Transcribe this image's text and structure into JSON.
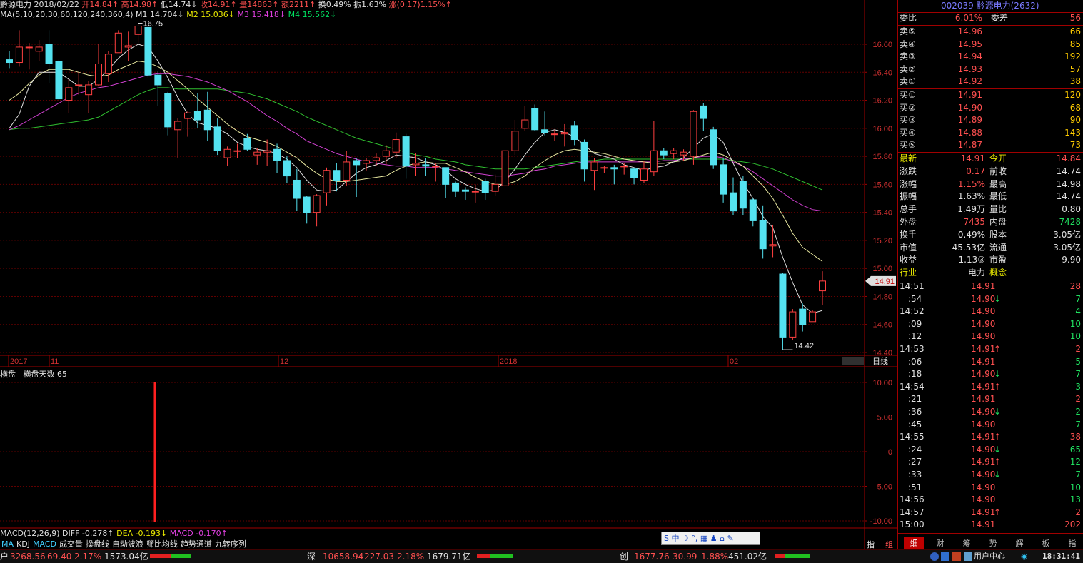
{
  "header": {
    "name": "黔源电力",
    "date": "2018/02/22",
    "open": "开14.84↑",
    "high": "高14.98↑",
    "low": "低14.74↓",
    "close": "收14.91↑",
    "volume": "量14863↑",
    "amount": "额2211↑",
    "turnover": "换0.49%",
    "amplitude": "振1.63%",
    "change": "涨(0.17)1.15%↑"
  },
  "ma_line": {
    "label": "MA(5,10,20,30,60,120,240,360,4)",
    "m1": "M1 14.704↓",
    "m2": "M2 15.036↓",
    "m3": "M3 15.418↓",
    "m4": "M4 15.562↓"
  },
  "chart_data": {
    "type": "candlestick",
    "y_ticks": [
      "16.60",
      "16.40",
      "16.20",
      "16.00",
      "15.80",
      "15.60",
      "15.40",
      "15.20",
      "15.00",
      "14.80",
      "14.60",
      "14.40"
    ],
    "ylim": [
      14.4,
      16.9
    ],
    "x_labels": [
      "2017",
      "11",
      "12",
      "2018",
      "02"
    ],
    "high_marker": "16.75",
    "low_marker": "14.42",
    "last_price_tag": "14.91",
    "period_label": "日线",
    "candles": [
      [
        16.49,
        16.47,
        16.55,
        16.43
      ],
      [
        16.47,
        16.58,
        16.7,
        16.44
      ],
      [
        16.58,
        16.58,
        16.61,
        16.42
      ],
      [
        16.55,
        16.58,
        16.63,
        16.48
      ],
      [
        16.6,
        16.46,
        16.7,
        16.32
      ],
      [
        16.48,
        16.21,
        16.49,
        16.2
      ],
      [
        16.2,
        16.29,
        16.35,
        16.11
      ],
      [
        16.31,
        16.31,
        16.4,
        16.24
      ],
      [
        16.24,
        16.31,
        16.34,
        16.11
      ],
      [
        16.31,
        16.46,
        16.6,
        16.3
      ],
      [
        16.39,
        16.53,
        16.55,
        16.33
      ],
      [
        16.54,
        16.68,
        16.7,
        16.54
      ],
      [
        16.58,
        16.59,
        16.69,
        16.48
      ],
      [
        16.67,
        16.73,
        16.75,
        16.61
      ],
      [
        16.72,
        16.38,
        16.73,
        16.36
      ],
      [
        16.38,
        16.31,
        16.41,
        16.16
      ],
      [
        16.25,
        16.01,
        16.26,
        15.95
      ],
      [
        15.99,
        16.05,
        16.07,
        15.79
      ],
      [
        16.07,
        16.11,
        16.12,
        15.94
      ],
      [
        16.12,
        16.06,
        16.25,
        16.0
      ],
      [
        16.13,
        15.99,
        16.26,
        15.91
      ],
      [
        16.01,
        15.84,
        16.07,
        15.81
      ],
      [
        15.79,
        15.85,
        15.87,
        15.73
      ],
      [
        15.84,
        15.84,
        15.89,
        15.79
      ],
      [
        15.93,
        15.85,
        15.96,
        15.84
      ],
      [
        15.81,
        15.83,
        15.86,
        15.74
      ],
      [
        15.83,
        15.84,
        15.92,
        15.73
      ],
      [
        15.85,
        15.77,
        15.89,
        15.68
      ],
      [
        15.77,
        15.66,
        15.8,
        15.61
      ],
      [
        15.63,
        15.5,
        15.71,
        15.41
      ],
      [
        15.51,
        15.4,
        15.52,
        15.32
      ],
      [
        15.4,
        15.52,
        15.53,
        15.3
      ],
      [
        15.54,
        15.7,
        15.72,
        15.45
      ],
      [
        15.7,
        15.63,
        15.75,
        15.55
      ],
      [
        15.63,
        15.76,
        15.84,
        15.59
      ],
      [
        15.77,
        15.74,
        15.79,
        15.51
      ],
      [
        15.75,
        15.77,
        15.79,
        15.7
      ],
      [
        15.77,
        15.79,
        15.82,
        15.73
      ],
      [
        15.8,
        15.84,
        15.88,
        15.74
      ],
      [
        15.83,
        15.92,
        15.97,
        15.79
      ],
      [
        15.94,
        15.73,
        15.96,
        15.64
      ],
      [
        15.74,
        15.75,
        15.82,
        15.66
      ],
      [
        15.74,
        15.73,
        15.79,
        15.66
      ],
      [
        15.73,
        15.73,
        15.75,
        15.62
      ],
      [
        15.72,
        15.6,
        15.72,
        15.5
      ],
      [
        15.61,
        15.55,
        15.62,
        15.51
      ],
      [
        15.56,
        15.55,
        15.58,
        15.49
      ],
      [
        15.55,
        15.55,
        15.6,
        15.47
      ],
      [
        15.62,
        15.54,
        15.64,
        15.49
      ],
      [
        15.55,
        15.6,
        15.67,
        15.52
      ],
      [
        15.59,
        15.84,
        15.94,
        15.57
      ],
      [
        15.84,
        15.98,
        16.06,
        15.81
      ],
      [
        16.0,
        16.06,
        16.16,
        15.98
      ],
      [
        16.14,
        15.99,
        16.17,
        15.98
      ],
      [
        15.99,
        15.97,
        16.12,
        15.95
      ],
      [
        15.96,
        15.96,
        15.99,
        15.91
      ],
      [
        15.96,
        15.97,
        16.03,
        15.87
      ],
      [
        16.02,
        15.92,
        16.05,
        15.88
      ],
      [
        15.9,
        15.71,
        15.92,
        15.62
      ],
      [
        15.7,
        15.76,
        15.79,
        15.56
      ],
      [
        15.72,
        15.72,
        15.73,
        15.68
      ],
      [
        15.72,
        15.71,
        15.74,
        15.6
      ],
      [
        15.73,
        15.73,
        15.75,
        15.67
      ],
      [
        15.71,
        15.65,
        15.72,
        15.6
      ],
      [
        15.63,
        15.71,
        15.77,
        15.61
      ],
      [
        15.69,
        15.84,
        16.05,
        15.66
      ],
      [
        15.84,
        15.81,
        15.86,
        15.78
      ],
      [
        15.82,
        15.84,
        15.86,
        15.78
      ],
      [
        15.81,
        15.83,
        15.85,
        15.77
      ],
      [
        15.8,
        16.12,
        16.13,
        15.74
      ],
      [
        16.16,
        16.07,
        16.18,
        15.98
      ],
      [
        15.99,
        15.74,
        16.01,
        15.71
      ],
      [
        15.74,
        15.53,
        15.79,
        15.47
      ],
      [
        15.54,
        15.41,
        15.65,
        15.38
      ],
      [
        15.62,
        15.43,
        15.66,
        15.38
      ],
      [
        15.49,
        15.34,
        15.5,
        15.3
      ],
      [
        15.34,
        15.14,
        15.45,
        15.07
      ],
      [
        15.16,
        15.17,
        15.31,
        15.08
      ],
      [
        14.96,
        14.51,
        14.97,
        14.42
      ],
      [
        14.51,
        14.69,
        14.71,
        14.49
      ],
      [
        14.71,
        14.6,
        14.75,
        14.55
      ],
      [
        14.62,
        14.69,
        14.7,
        14.65
      ],
      [
        14.84,
        14.91,
        14.98,
        14.74
      ]
    ],
    "ma5_y": [
      16.0,
      16.1,
      16.3,
      16.4,
      16.4,
      16.4,
      16.35,
      16.3,
      16.3,
      16.35,
      16.42,
      16.5,
      16.56,
      16.6,
      16.58,
      16.48,
      16.36,
      16.22,
      16.1,
      16.04,
      16.02,
      16.0,
      15.96,
      15.9,
      15.87,
      15.85,
      15.84,
      15.82,
      15.78,
      15.72,
      15.63,
      15.56,
      15.55,
      15.56,
      15.62,
      15.68,
      15.72,
      15.74,
      15.77,
      15.81,
      15.8,
      15.79,
      15.76,
      15.74,
      15.7,
      15.64,
      15.6,
      15.57,
      15.55,
      15.56,
      15.62,
      15.71,
      15.81,
      15.9,
      15.97,
      15.99,
      15.97,
      15.94,
      15.88,
      15.82,
      15.8,
      15.78,
      15.74,
      15.72,
      15.7,
      15.72,
      15.73,
      15.76,
      15.79,
      15.86,
      15.93,
      15.96,
      15.9,
      15.75,
      15.61,
      15.5,
      15.37,
      15.29,
      15.08,
      14.9,
      14.74,
      14.68,
      14.7
    ],
    "ma10_y": [
      16.2,
      16.25,
      16.32,
      16.38,
      16.42,
      16.42,
      16.42,
      16.4,
      16.38,
      16.37,
      16.38,
      16.42,
      16.45,
      16.48,
      16.47,
      16.44,
      16.4,
      16.34,
      16.28,
      16.21,
      16.15,
      16.09,
      16.03,
      15.98,
      15.94,
      15.92,
      15.9,
      15.87,
      15.83,
      15.79,
      15.73,
      15.68,
      15.64,
      15.62,
      15.62,
      15.63,
      15.64,
      15.65,
      15.66,
      15.7,
      15.73,
      15.75,
      15.76,
      15.75,
      15.75,
      15.72,
      15.69,
      15.65,
      15.62,
      15.6,
      15.6,
      15.62,
      15.66,
      15.72,
      15.77,
      15.81,
      15.84,
      15.85,
      15.84,
      15.83,
      15.82,
      15.8,
      15.78,
      15.77,
      15.76,
      15.75,
      15.75,
      15.76,
      15.77,
      15.79,
      15.81,
      15.83,
      15.81,
      15.77,
      15.73,
      15.66,
      15.59,
      15.5,
      15.38,
      15.25,
      15.15,
      15.1,
      15.05
    ],
    "ma20_y": [
      15.99,
      16.02,
      16.06,
      16.1,
      16.14,
      16.18,
      16.22,
      16.25,
      16.27,
      16.29,
      16.3,
      16.32,
      16.34,
      16.36,
      16.38,
      16.39,
      16.39,
      16.38,
      16.37,
      16.35,
      16.33,
      16.3,
      16.27,
      16.23,
      16.19,
      16.14,
      16.09,
      16.05,
      16.0,
      15.96,
      15.91,
      15.88,
      15.85,
      15.82,
      15.8,
      15.78,
      15.76,
      15.75,
      15.74,
      15.73,
      15.73,
      15.72,
      15.72,
      15.72,
      15.71,
      15.7,
      15.69,
      15.68,
      15.67,
      15.66,
      15.66,
      15.67,
      15.68,
      15.7,
      15.71,
      15.73,
      15.74,
      15.75,
      15.76,
      15.76,
      15.76,
      15.76,
      15.76,
      15.76,
      15.76,
      15.76,
      15.77,
      15.77,
      15.78,
      15.79,
      15.8,
      15.8,
      15.79,
      15.76,
      15.73,
      15.69,
      15.64,
      15.59,
      15.54,
      15.49,
      15.45,
      15.42,
      15.41
    ],
    "ma30_y": [
      15.99,
      16.0,
      16.0,
      16.01,
      16.02,
      16.03,
      16.04,
      16.05,
      16.06,
      16.08,
      16.12,
      16.16,
      16.2,
      16.24,
      16.27,
      16.29,
      16.29,
      16.28,
      16.28,
      16.28,
      16.28,
      16.28,
      16.27,
      16.26,
      16.25,
      16.23,
      16.21,
      16.18,
      16.15,
      16.12,
      16.08,
      16.05,
      16.02,
      15.99,
      15.96,
      15.93,
      15.91,
      15.89,
      15.87,
      15.85,
      15.83,
      15.81,
      15.8,
      15.78,
      15.77,
      15.76,
      15.74,
      15.73,
      15.72,
      15.71,
      15.71,
      15.71,
      15.71,
      15.72,
      15.73,
      15.74,
      15.75,
      15.76,
      15.77,
      15.77,
      15.78,
      15.78,
      15.78,
      15.78,
      15.78,
      15.78,
      15.78,
      15.78,
      15.78,
      15.78,
      15.78,
      15.78,
      15.78,
      15.77,
      15.76,
      15.75,
      15.73,
      15.71,
      15.68,
      15.65,
      15.62,
      15.59,
      15.56
    ]
  },
  "indicator": {
    "label": "横盘",
    "days_label": "横盘天数 65",
    "y_ticks": [
      "10.00",
      "5.00",
      "0",
      "-5.00",
      "-10.00"
    ]
  },
  "macd": {
    "label": "MACD(12,26,9)",
    "diff": "DIFF -0.278↑",
    "dea": "DEA -0.193↓",
    "macd": "MACD -0.170↑"
  },
  "tabs": [
    "MA",
    "KDJ",
    "MACD",
    "成交量",
    "操盘线",
    "自动波浪",
    "筛比均线",
    "趋势通道",
    "九转序列"
  ],
  "ime_bar": "S 中 ☽ °, ▦ ♟ ⌂ ✎",
  "side": {
    "title": "002039 黔源电力(2632)",
    "weibi_label": "委比",
    "weibi_value": "6.01%",
    "weicha_label": "委差",
    "weicha_value": "56",
    "asks": [
      {
        "label": "卖⑤",
        "price": "14.96",
        "vol": "66"
      },
      {
        "label": "卖④",
        "price": "14.95",
        "vol": "85"
      },
      {
        "label": "卖③",
        "price": "14.94",
        "vol": "192"
      },
      {
        "label": "卖②",
        "price": "14.93",
        "vol": "57"
      },
      {
        "label": "卖①",
        "price": "14.92",
        "vol": "38"
      }
    ],
    "bids": [
      {
        "label": "买①",
        "price": "14.91",
        "vol": "120"
      },
      {
        "label": "买②",
        "price": "14.90",
        "vol": "68"
      },
      {
        "label": "买③",
        "price": "14.89",
        "vol": "90"
      },
      {
        "label": "买④",
        "price": "14.88",
        "vol": "143"
      },
      {
        "label": "买⑤",
        "price": "14.87",
        "vol": "73"
      }
    ],
    "stats": [
      {
        "k1": "最新",
        "v1": "14.91",
        "k2": "今开",
        "v2": "14.84"
      },
      {
        "k1": "涨跌",
        "v1": "0.17",
        "k2": "前收",
        "v2": "14.74"
      },
      {
        "k1": "涨幅",
        "v1": "1.15%",
        "k2": "最高",
        "v2": "14.98"
      },
      {
        "k1": "振幅",
        "v1": "1.63%",
        "k2": "最低",
        "v2": "14.74"
      },
      {
        "k1": "总手",
        "v1": "1.49万",
        "k2": "量比",
        "v2": "0.80"
      },
      {
        "k1": "外盘",
        "v1": "7435",
        "k2": "内盘",
        "v2": "7428"
      },
      {
        "k1": "换手",
        "v1": "0.49%",
        "k2": "股本",
        "v2": "3.05亿"
      },
      {
        "k1": "市值",
        "v1": "45.53亿",
        "k2": "流通",
        "v2": "3.05亿"
      },
      {
        "k1": "收益",
        "v1": "1.13③",
        "k2": "市盈",
        "v2": "9.90"
      },
      {
        "k1": "行业",
        "v1": "电力",
        "k2": "概念",
        "v2": ""
      }
    ],
    "ticks": [
      {
        "t": "14:51",
        "p": "14.91",
        "a": "",
        "v": "28"
      },
      {
        "t": ":54",
        "p": "14.90",
        "a": "↓",
        "v": "7"
      },
      {
        "t": "14:52",
        "p": "14.90",
        "a": "",
        "v": "4"
      },
      {
        "t": ":09",
        "p": "14.90",
        "a": "",
        "v": "10"
      },
      {
        "t": ":12",
        "p": "14.90",
        "a": "",
        "v": "10"
      },
      {
        "t": "14:53",
        "p": "14.91",
        "a": "↑",
        "v": "2"
      },
      {
        "t": ":06",
        "p": "14.91",
        "a": "",
        "v": "5"
      },
      {
        "t": ":18",
        "p": "14.90",
        "a": "↓",
        "v": "7"
      },
      {
        "t": "14:54",
        "p": "14.91",
        "a": "↑",
        "v": "3"
      },
      {
        "t": ":21",
        "p": "14.91",
        "a": "",
        "v": "2"
      },
      {
        "t": ":36",
        "p": "14.90",
        "a": "↓",
        "v": "2"
      },
      {
        "t": ":45",
        "p": "14.90",
        "a": "",
        "v": "7"
      },
      {
        "t": "14:55",
        "p": "14.91",
        "a": "↑",
        "v": "38"
      },
      {
        "t": ":24",
        "p": "14.90",
        "a": "↓",
        "v": "65"
      },
      {
        "t": ":27",
        "p": "14.91",
        "a": "↑",
        "v": "12"
      },
      {
        "t": ":33",
        "p": "14.90",
        "a": "↓",
        "v": "7"
      },
      {
        "t": ":51",
        "p": "14.90",
        "a": "",
        "v": "10"
      },
      {
        "t": "14:56",
        "p": "14.90",
        "a": "",
        "v": "13"
      },
      {
        "t": "14:57",
        "p": "14.91",
        "a": "↑",
        "v": "2"
      },
      {
        "t": "15:00",
        "p": "14.91",
        "a": "",
        "v": "202"
      }
    ],
    "bottom_tabs": [
      "细",
      "财",
      "筹",
      "势",
      "解",
      "板",
      "指"
    ]
  },
  "bottom": {
    "left_cut": "户",
    "sh_value": "3268.56",
    "sh_change": "69.40",
    "sh_pct": "2.17%",
    "sh_amount": "1573.04亿",
    "sz_label": "深",
    "sz_value": "10658.94",
    "sz_change": "227.03",
    "sz_pct": "2.18%",
    "sz_amount": "1679.71亿",
    "cy_label": "创",
    "cy_value": "1677.76",
    "cy_change": "30.99",
    "cy_pct": "1.88%",
    "cy_amount": "451.02亿",
    "user_center": "用户中心",
    "clock": "18:31:41",
    "zhi": "指",
    "zu": "组"
  },
  "colors": {
    "up": "#ff4040",
    "down": "#54e2f0",
    "grid": "#700000",
    "ma5": "#e0e0e0",
    "ma10": "#e8e8a0",
    "ma20": "#d040d0",
    "ma30": "#30c030"
  }
}
